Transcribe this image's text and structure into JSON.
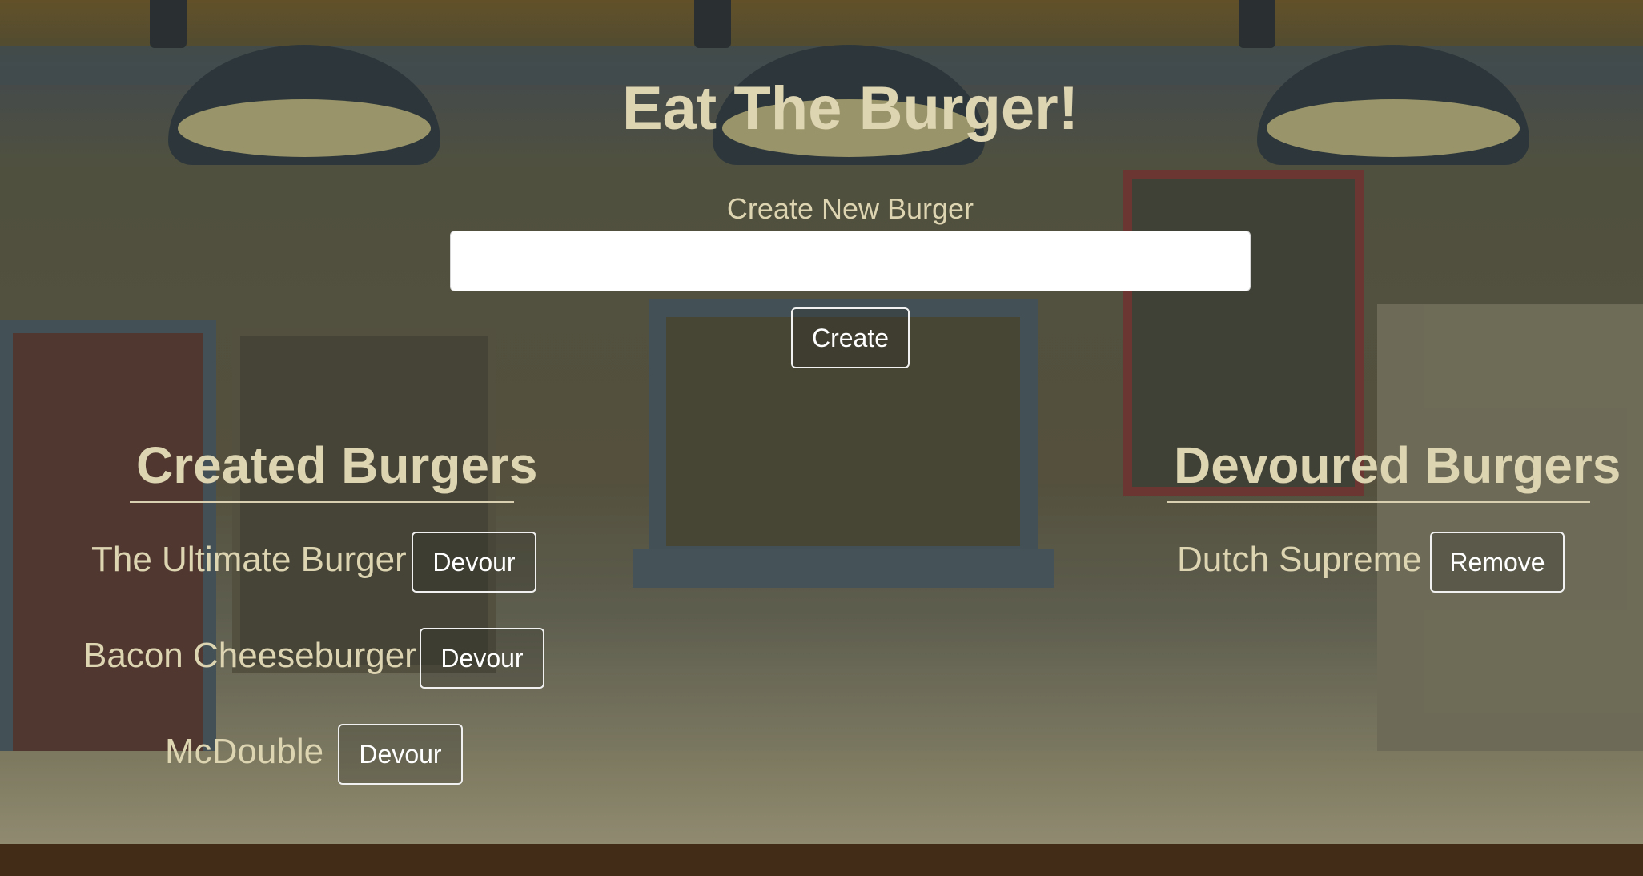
{
  "header": {
    "title": "Eat The Burger!"
  },
  "create_form": {
    "label": "Create New Burger",
    "input_value": "",
    "input_placeholder": "",
    "button_label": "Create"
  },
  "created_section": {
    "heading": "Created Burgers",
    "items": [
      {
        "name": "The Ultimate Burger",
        "action": "Devour"
      },
      {
        "name": "Bacon Cheeseburger",
        "action": "Devour"
      },
      {
        "name": "McDouble",
        "action": "Devour"
      }
    ]
  },
  "devoured_section": {
    "heading": "Devoured Burgers",
    "items": [
      {
        "name": "Dutch Supreme",
        "action": "Remove"
      }
    ]
  },
  "colors": {
    "text_accent": "#ddd4b2",
    "button_border": "#f1f1f1",
    "input_bg": "#ffffff"
  }
}
